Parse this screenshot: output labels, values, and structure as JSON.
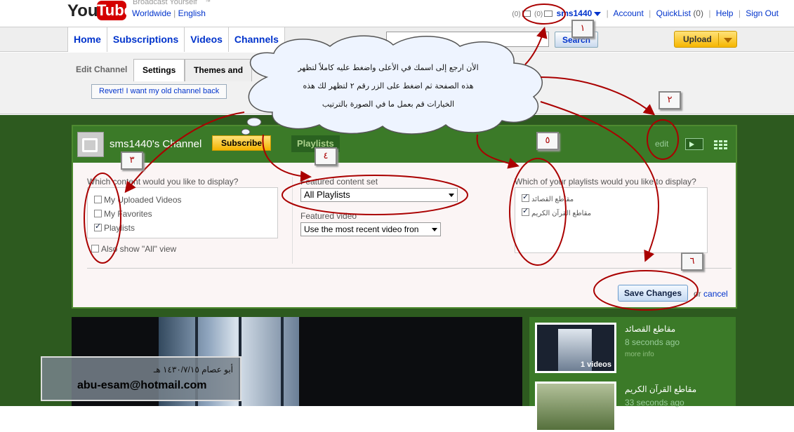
{
  "header": {
    "logo_you": "You",
    "logo_tube": "Tube",
    "tagline": "Broadcast Yourself",
    "tm": "™",
    "locale_worldwide": "Worldwide",
    "locale_sep": "|",
    "locale_lang": "English",
    "mail_count": "(0)",
    "tv_count": "(0)",
    "username": "sms1440",
    "account": "Account",
    "quicklist": "QuickList",
    "quicklist_count": "(0)",
    "help": "Help",
    "signout": "Sign Out"
  },
  "nav": {
    "tabs": [
      "Home",
      "Subscriptions",
      "Videos",
      "Channels"
    ],
    "search_button": "Search",
    "upload_button": "Upload"
  },
  "edit_bar": {
    "label": "Edit Channel",
    "tab_settings": "Settings",
    "tab_themes": "Themes and",
    "revert": "Revert! I want my old channel back"
  },
  "channel": {
    "title": "sms1440's Channel",
    "subscribe": "Subscribe",
    "playlists_tab": "Playlists",
    "edit": "edit",
    "q_content": "Which content would you like to display?",
    "options": [
      {
        "label": "My Uploaded Videos",
        "checked": false
      },
      {
        "label": "My Favorites",
        "checked": false
      },
      {
        "label": "Playlists",
        "checked": true
      }
    ],
    "also_show_all": "Also show \"All\" view",
    "featured_set_label": "Featured content set",
    "featured_set_value": "All Playlists",
    "featured_video_label": "Featured video",
    "featured_video_value": "Use the most recent video fron",
    "q_playlists": "Which of your playlists would you like to display?",
    "playlists": [
      {
        "label": "مقاطع القصائد",
        "checked": true
      },
      {
        "label": "مقاطع القرآن الكريم",
        "checked": true
      }
    ],
    "save_changes": "Save Changes",
    "or_cancel_or": "or",
    "cancel": "cancel"
  },
  "sidebar_playlists": [
    {
      "title": "مقاطع القصائد",
      "time": "8 seconds ago",
      "more": "more info",
      "badge": "1 videos"
    },
    {
      "title": "مقاطع القرآن الكريم",
      "time": "33 seconds ago"
    }
  ],
  "annotation": {
    "cloud_line1": "الأن ارجع إلى اسمك في الأعلى واضغط عليه كاملاً لتظهر",
    "cloud_line2": "هذه الصفحة ثم اضغط على الزر رقم ٢ لتظهر لك هذه",
    "cloud_line3": "الخيارات قم بعمل ما في الصورة بالترتيب",
    "num1": "١",
    "num2": "٢",
    "num3": "٣",
    "num4": "٤",
    "num5": "٥",
    "num6": "٦"
  },
  "signature": {
    "arabic": "أبو عصام ١٤٣٠/٧/١٥ هـ",
    "email": "abu-esam@hotmail.com"
  },
  "colors": {
    "annotation_red": "#aa0000",
    "channel_green": "#3b7a28",
    "link_blue": "#0033cc"
  }
}
